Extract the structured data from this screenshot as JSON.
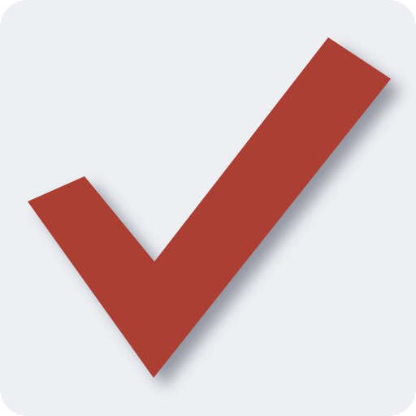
{
  "app_icon": {
    "icon": "checkmark-icon",
    "colors": {
      "background": "#eeeff3",
      "checkmark": "#ab3f34",
      "shadow": "#4a4e5e"
    }
  }
}
